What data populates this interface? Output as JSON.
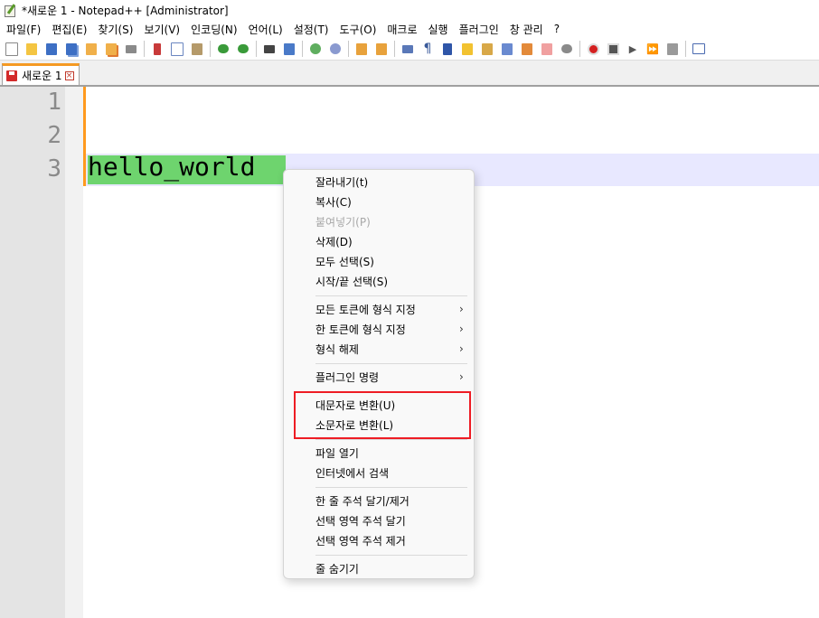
{
  "window": {
    "title": "*새로운 1 - Notepad++ [Administrator]"
  },
  "menu": [
    "파일(F)",
    "편집(E)",
    "찾기(S)",
    "보기(V)",
    "인코딩(N)",
    "언어(L)",
    "설정(T)",
    "도구(O)",
    "매크로",
    "실행",
    "플러그인",
    "창 관리",
    "?"
  ],
  "toolbar": {
    "icons": [
      "new-file-icon",
      "open-file-icon",
      "save-icon",
      "save-all-icon",
      "close-icon",
      "close-all-icon",
      "print-icon",
      "cut-icon",
      "copy-icon",
      "paste-icon",
      "undo-icon",
      "redo-icon",
      "find-icon",
      "replace-icon",
      "zoom-in-icon",
      "zoom-out-icon",
      "sync-vertical-icon",
      "sync-horizontal-icon",
      "word-wrap-icon",
      "show-all-chars-icon",
      "indent-guide-icon",
      "language-icon",
      "doc-map-icon",
      "function-list-icon",
      "folder-as-workspace-icon",
      "monitoring-icon",
      "record-macro-icon",
      "stop-record-icon",
      "play-macro-icon",
      "run-multiple-macro-icon",
      "save-macro-icon",
      "launch-icon"
    ]
  },
  "tab": {
    "label": "새로운 1"
  },
  "editor": {
    "line_numbers": [
      "1",
      "2",
      "3"
    ],
    "lines": [
      "",
      "",
      "hello_world"
    ],
    "selected_text": "hello_world"
  },
  "context_menu": {
    "items": [
      {
        "label": "잘라내기(t)",
        "enabled": true
      },
      {
        "label": "복사(C)",
        "enabled": true
      },
      {
        "label": "붙여넣기(P)",
        "enabled": false
      },
      {
        "label": "삭제(D)",
        "enabled": true
      },
      {
        "label": "모두 선택(S)",
        "enabled": true
      },
      {
        "label": "시작/끝 선택(S)",
        "enabled": true
      },
      {
        "label": "모든 토큰에 형식 지정",
        "submenu": true
      },
      {
        "label": "한 토큰에 형식 지정",
        "submenu": true
      },
      {
        "label": "형식 해제",
        "submenu": true
      },
      {
        "label": "플러그인 명령",
        "submenu": true
      },
      {
        "label": "대문자로 변환(U)",
        "enabled": true
      },
      {
        "label": "소문자로 변환(L)",
        "enabled": true
      },
      {
        "label": "파일 열기",
        "enabled": true
      },
      {
        "label": "인터넷에서 검색",
        "enabled": true
      },
      {
        "label": "한 줄 주석 달기/제거",
        "enabled": true
      },
      {
        "label": "선택 영역 주석 달기",
        "enabled": true
      },
      {
        "label": "선택 영역 주석 제거",
        "enabled": true
      },
      {
        "label": "줄 숨기기",
        "enabled": true
      }
    ],
    "submenu_arrow": "›"
  },
  "colors": {
    "tab_accent": "#f59a23",
    "selection": "#6ed46e",
    "current_line": "#e8e8ff",
    "highlight_box": "#ee1c24"
  }
}
